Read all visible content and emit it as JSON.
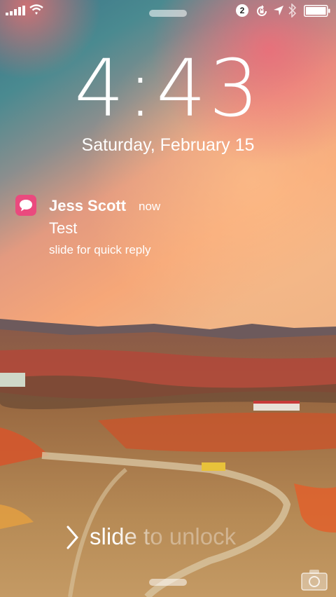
{
  "status_bar": {
    "signal_icon": "cellular-signal-icon",
    "wifi_icon": "wifi-icon",
    "notification_count": "2",
    "rotation_lock_icon": "rotation-lock-icon",
    "location_icon": "location-arrow-icon",
    "bluetooth_icon": "bluetooth-icon",
    "battery_icon": "battery-icon",
    "battery_level": 1.0
  },
  "lock_screen": {
    "time": "4:43",
    "date": "Saturday, February 15"
  },
  "notification": {
    "app_icon": "messages-icon",
    "app_color": "#ea4a7e",
    "sender": "Jess Scott",
    "time_ago": "now",
    "message": "Test",
    "action_hint": "slide for quick reply"
  },
  "unlock": {
    "chevron_icon": "chevron-right-icon",
    "label": "slide to unlock"
  },
  "camera_icon": "camera-icon"
}
